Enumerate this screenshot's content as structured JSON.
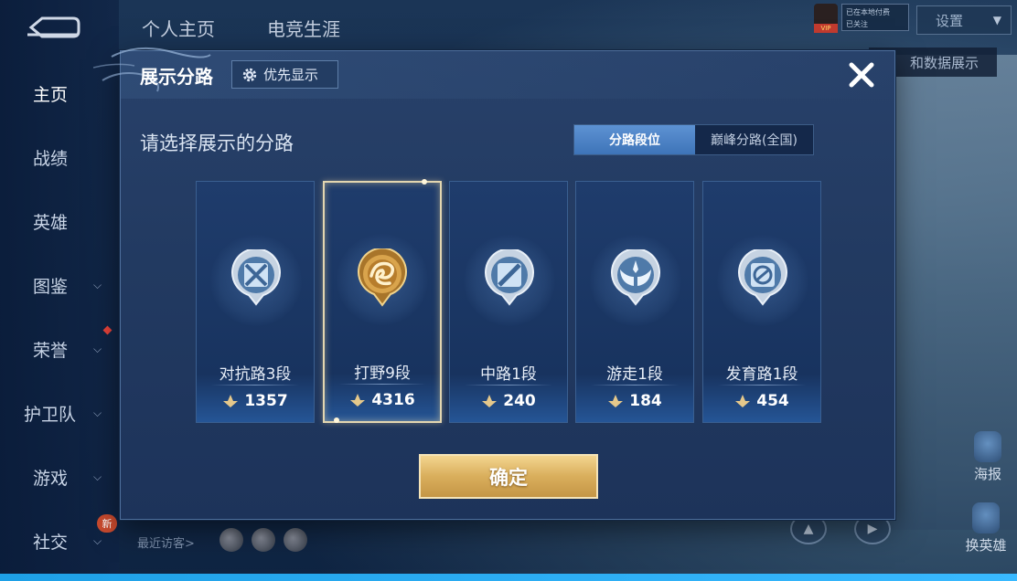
{
  "top_tabs": [
    "个人主页",
    "电竞生涯"
  ],
  "settings_label": "设置",
  "vip_label": "VIP",
  "mini_box_text": [
    "已在本地付费",
    "已关注"
  ],
  "data_note": "和数据展示",
  "sidebar": {
    "items": [
      {
        "label": "主页",
        "has_chevron": false
      },
      {
        "label": "战绩",
        "has_chevron": false
      },
      {
        "label": "英雄",
        "has_chevron": false
      },
      {
        "label": "图鉴",
        "has_chevron": true
      },
      {
        "label": "荣誉",
        "has_chevron": true
      },
      {
        "label": "护卫队",
        "has_chevron": true
      },
      {
        "label": "游戏",
        "has_chevron": true
      },
      {
        "label": "社交",
        "has_chevron": true
      }
    ],
    "new_badge": "新"
  },
  "recent_visitors_label": "最近访客>",
  "right_buttons": {
    "poster": "海报",
    "switch_hero": "换英雄"
  },
  "modal": {
    "title": "展示分路",
    "priority_button": "优先显示",
    "subtitle": "请选择展示的分路",
    "segments": [
      {
        "label": "分路段位",
        "active": true
      },
      {
        "label": "巅峰分路(全国)",
        "active": false
      }
    ],
    "lanes": [
      {
        "name": "对抗路3段",
        "score": "1357",
        "icon": "clash-lane-icon",
        "selected": false
      },
      {
        "name": "打野9段",
        "score": "4316",
        "icon": "jungle-dragon-icon",
        "selected": true
      },
      {
        "name": "中路1段",
        "score": "240",
        "icon": "mid-lane-icon",
        "selected": false
      },
      {
        "name": "游走1段",
        "score": "184",
        "icon": "roam-wings-icon",
        "selected": false
      },
      {
        "name": "发育路1段",
        "score": "454",
        "icon": "farm-lane-icon",
        "selected": false
      }
    ],
    "confirm_button": "确定"
  },
  "colors": {
    "modal_bg": "#223a61",
    "accent_blue": "#4a82c6",
    "gold": "#d9ae5c",
    "selected_border": "#e3d6b0"
  }
}
